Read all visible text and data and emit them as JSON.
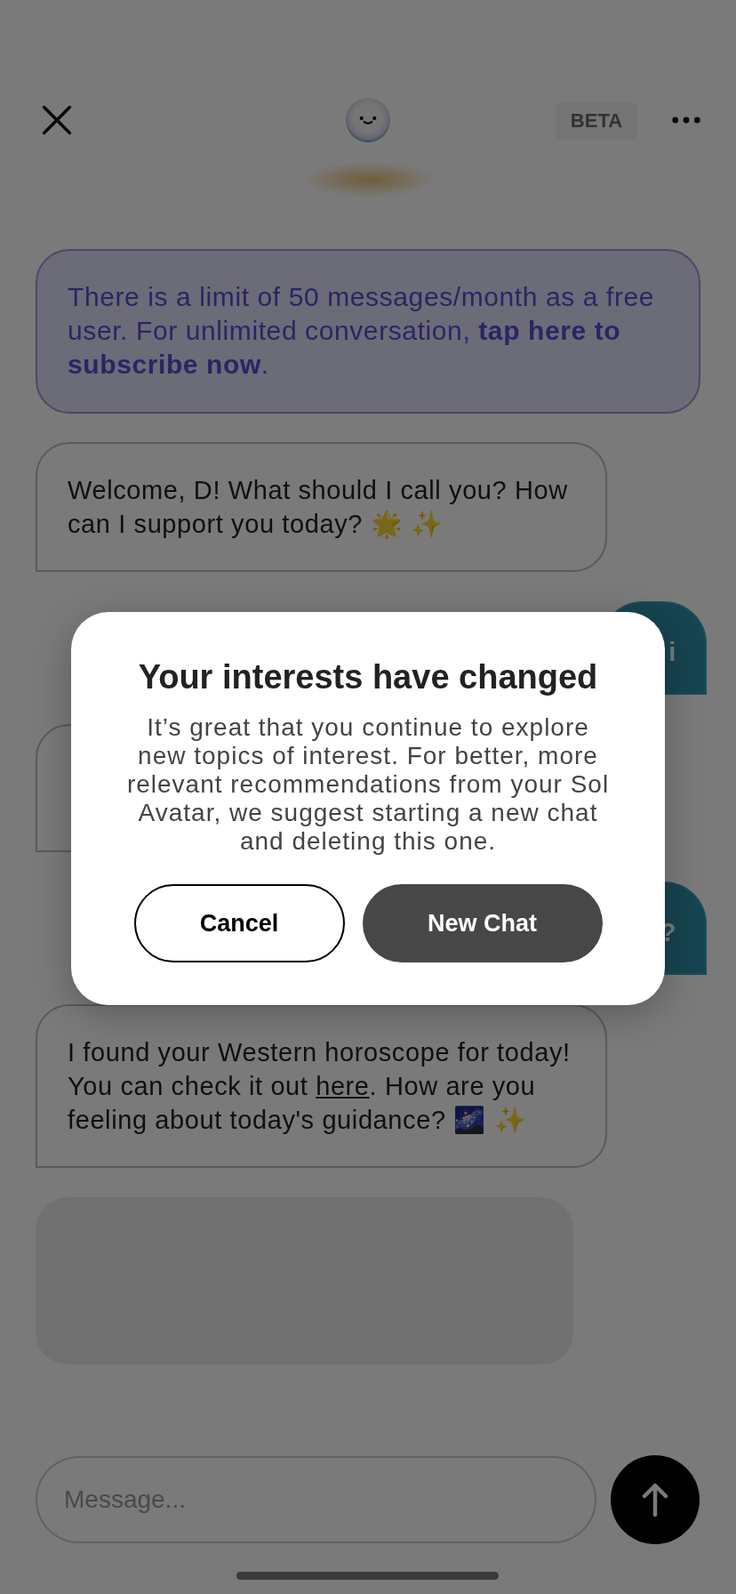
{
  "header": {
    "badge": "BETA"
  },
  "banner": {
    "text": "There is a limit of 50 messages/month as a free user. For unlimited conversation, **tap here to subscribe now**."
  },
  "messages": [
    {
      "kind": "bot",
      "text": "Welcome, D! What should I call you? How can I support you today? 🌟 ✨"
    },
    {
      "kind": "user",
      "text": "i"
    },
    {
      "kind": "bot"
    },
    {
      "kind": "user",
      "text": "?"
    },
    {
      "kind": "bot",
      "text": "I found your Western horoscope for today! You can check it out ",
      "link": "here",
      "text_after": ". How are you feeling about today's guidance? 🌌 ✨"
    },
    {
      "kind": "loading"
    }
  ],
  "composer": {
    "placeholder": "Message..."
  },
  "dialog": {
    "title": "Your interests have changed",
    "body": "It’s great that you continue to explore new topics of interest. For better, more relevant recommendations from your Sol Avatar, we suggest starting a new chat and deleting this one.",
    "buttons": [
      {
        "label": "Cancel",
        "kind": "secondary"
      },
      {
        "label": "New Chat",
        "kind": "primary"
      }
    ]
  }
}
